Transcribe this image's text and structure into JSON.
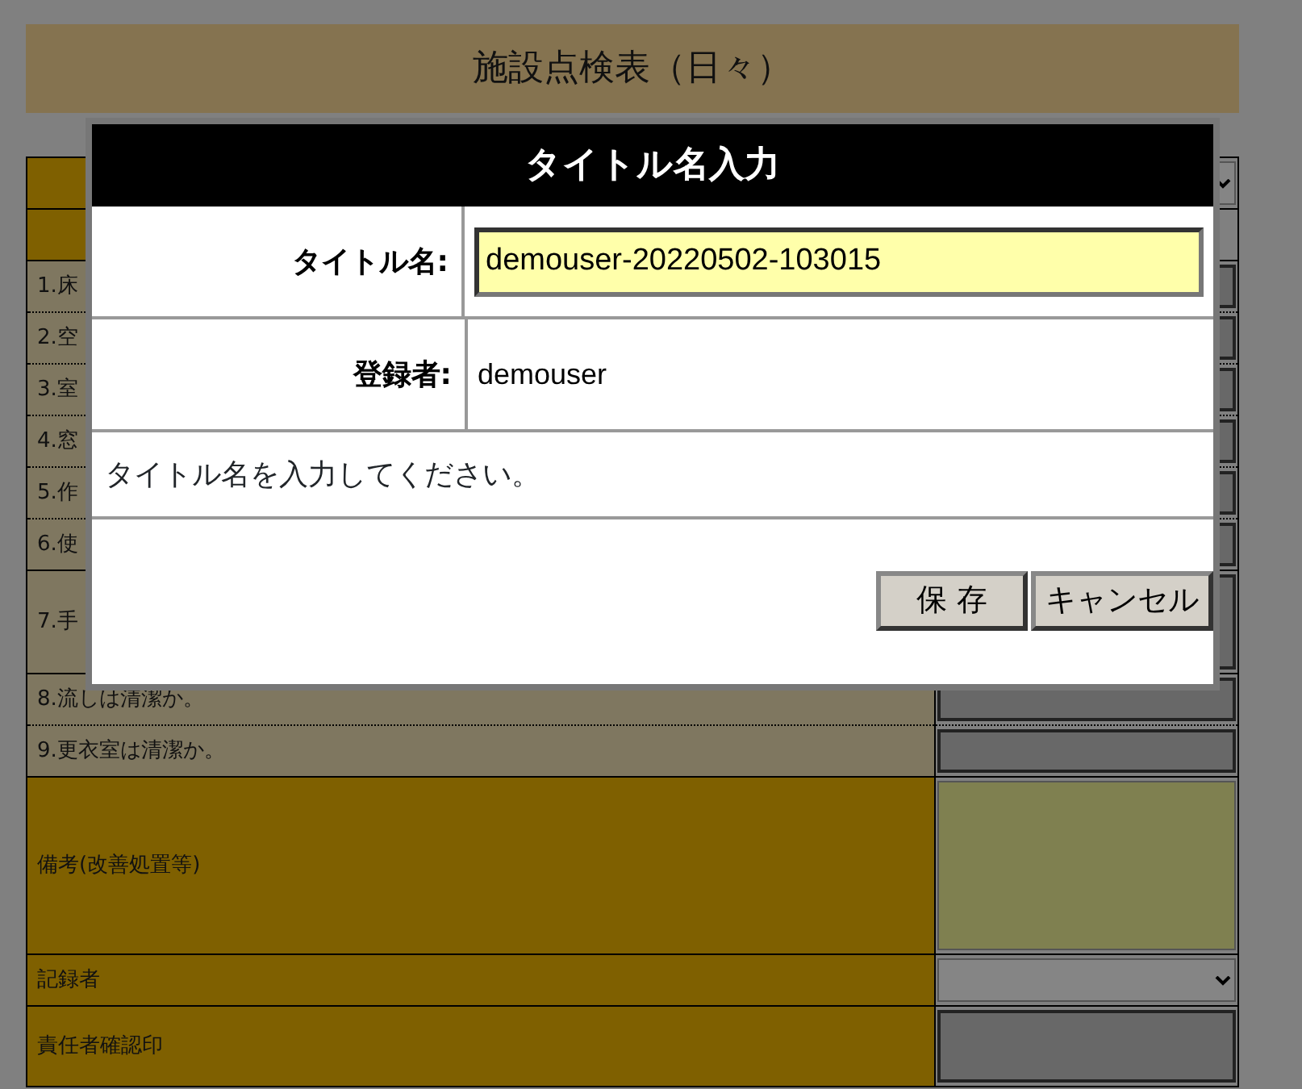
{
  "page": {
    "title": "施設点検表（日々）"
  },
  "sheet": {
    "rows": [
      {
        "kind": "top"
      },
      {
        "kind": "header"
      },
      {
        "kind": "item",
        "label": "1.床"
      },
      {
        "kind": "item",
        "label": "2.空"
      },
      {
        "kind": "item",
        "label": "3.室"
      },
      {
        "kind": "item",
        "label": "4.窓"
      },
      {
        "kind": "item",
        "label": "5.作"
      },
      {
        "kind": "item",
        "label": "6.使"
      },
      {
        "kind": "tall",
        "label": "7.手"
      },
      {
        "kind": "item",
        "label": "8.流しは清潔か。"
      },
      {
        "kind": "item",
        "label": "9.更衣室は清潔か。"
      },
      {
        "kind": "remarks",
        "label": "備考(改善処置等)"
      },
      {
        "kind": "field",
        "label": "記録者"
      },
      {
        "kind": "stamp",
        "label": "責任者確認印"
      }
    ]
  },
  "dialog": {
    "title": "タイトル名入力",
    "fields": [
      {
        "label": "タイトル名:",
        "kind": "input",
        "value": "demouser-20220502-103015"
      },
      {
        "label": "登録者:",
        "kind": "text",
        "value": "demouser"
      }
    ],
    "message": "タイトル名を入力してください。",
    "buttons": [
      "保 存",
      "キャンセル"
    ]
  }
}
